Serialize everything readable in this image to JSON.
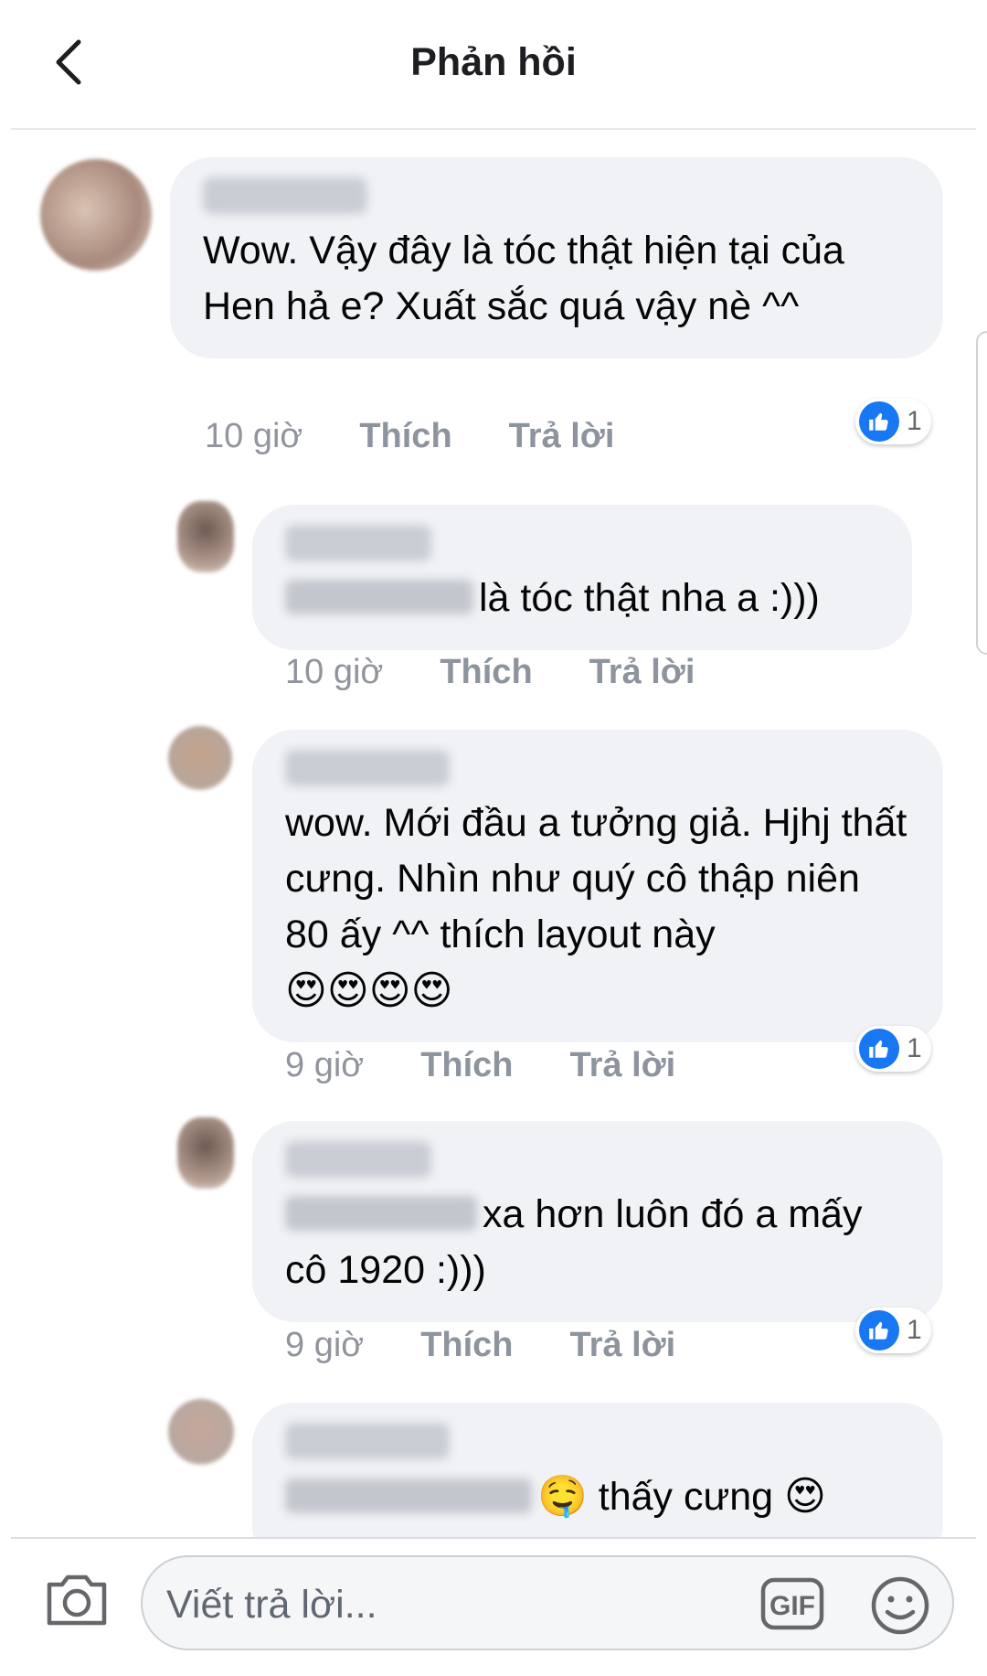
{
  "header": {
    "title": "Phản hồi",
    "back_icon": "back-chevron-icon"
  },
  "comments": [
    {
      "text": "Wow. Vậy đây là tóc thật hiện tại của Hen hả e? Xuất sắc quá vậy nè ^^",
      "time": "10 giờ",
      "like": "Thích",
      "reply": "Trả lời",
      "reactions": "1"
    },
    {
      "text": "là tóc thật nha a :)))",
      "time": "10 giờ",
      "like": "Thích",
      "reply": "Trả lời"
    },
    {
      "text": "wow. Mới đầu a tưởng giả. Hjhj thất cưng. Nhìn như quý cô thập niên 80 ấy ^^ thích layout này",
      "emojis": "😍😍😍😍",
      "time": "9 giờ",
      "like": "Thích",
      "reply": "Trả lời",
      "reactions": "1"
    },
    {
      "text": "xa hơn luôn đó a mấy cô 1920 :)))",
      "time": "9 giờ",
      "like": "Thích",
      "reply": "Trả lời",
      "reactions": "1"
    },
    {
      "emoji_1": "🤤",
      "text": "thấy cưng",
      "emoji_2": "😍"
    }
  ],
  "composer": {
    "placeholder": "Viết trả lời...",
    "gif_label": "GIF"
  },
  "colors": {
    "accent": "#1877f2",
    "bubble": "#f0f2f5",
    "meta": "#90949c"
  }
}
